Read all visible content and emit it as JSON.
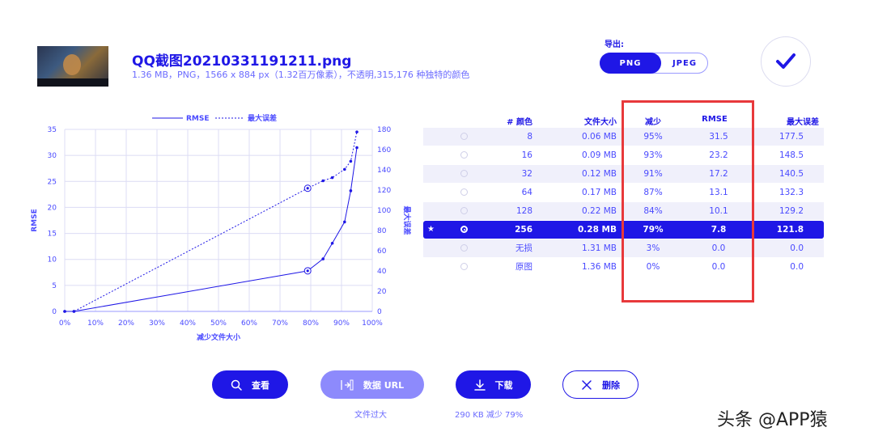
{
  "file": {
    "name": "QQ截图20210331191211.png",
    "info": "1.36 MB，PNG，1566 x 884 px（1.32百万像素），不透明,315,176 种独特的颜色"
  },
  "export": {
    "label": "导出:",
    "formats": [
      "PNG",
      "JPEG"
    ],
    "selected": "PNG"
  },
  "table": {
    "headers": [
      "# 颜色",
      "文件大小",
      "减少",
      "RMSE",
      "最大误差"
    ],
    "rows": [
      {
        "colors": "8",
        "size": "0.06 MB",
        "reduction": "95%",
        "rmse": "31.5",
        "max_error": "177.5",
        "selected": false
      },
      {
        "colors": "16",
        "size": "0.09 MB",
        "reduction": "93%",
        "rmse": "23.2",
        "max_error": "148.5",
        "selected": false
      },
      {
        "colors": "32",
        "size": "0.12 MB",
        "reduction": "91%",
        "rmse": "17.2",
        "max_error": "140.5",
        "selected": false
      },
      {
        "colors": "64",
        "size": "0.17 MB",
        "reduction": "87%",
        "rmse": "13.1",
        "max_error": "132.3",
        "selected": false
      },
      {
        "colors": "128",
        "size": "0.22 MB",
        "reduction": "84%",
        "rmse": "10.1",
        "max_error": "129.2",
        "selected": false
      },
      {
        "colors": "256",
        "size": "0.28 MB",
        "reduction": "79%",
        "rmse": "7.8",
        "max_error": "121.8",
        "selected": true
      },
      {
        "colors": "无损",
        "size": "1.31 MB",
        "reduction": "3%",
        "rmse": "0.0",
        "max_error": "0.0",
        "selected": false
      },
      {
        "colors": "原图",
        "size": "1.36 MB",
        "reduction": "0%",
        "rmse": "0.0",
        "max_error": "0.0",
        "selected": false
      }
    ]
  },
  "chart_data": {
    "type": "line",
    "xlabel": "减少文件大小",
    "ylabel": "RMSE",
    "y2label": "最大误差",
    "xlim": [
      0,
      100
    ],
    "ylim": [
      0,
      35
    ],
    "y2lim": [
      0,
      180
    ],
    "x_ticks": [
      "0%",
      "10%",
      "20%",
      "30%",
      "40%",
      "50%",
      "60%",
      "70%",
      "80%",
      "90%",
      "100%"
    ],
    "y_ticks": [
      "0",
      "5",
      "10",
      "15",
      "20",
      "25",
      "30",
      "35"
    ],
    "y2_ticks": [
      "0",
      "20",
      "40",
      "60",
      "80",
      "100",
      "120",
      "140",
      "160",
      "180"
    ],
    "legend": [
      "RMSE",
      "最大误差"
    ],
    "legend_position": "top",
    "grid": true,
    "series": [
      {
        "name": "RMSE",
        "style": "solid",
        "axis": "left",
        "x": [
          0,
          3,
          79,
          84,
          87,
          91,
          93,
          95
        ],
        "y": [
          0,
          0,
          7.8,
          10.1,
          13.1,
          17.2,
          23.2,
          31.5
        ],
        "highlight_index": 2
      },
      {
        "name": "最大误差",
        "style": "dotted",
        "axis": "right",
        "x": [
          0,
          3,
          79,
          84,
          87,
          91,
          93,
          95
        ],
        "y": [
          0,
          0,
          121.8,
          129.2,
          132.3,
          140.5,
          148.5,
          177.5
        ],
        "highlight_index": 2
      }
    ]
  },
  "buttons": {
    "view": "查看",
    "data_url": "数据 URL",
    "download": "下载",
    "delete": "删除"
  },
  "captions": {
    "data_url_note": "文件过大",
    "download_note": "290 KB  减少 79%"
  },
  "watermark": "头条 @APP猿",
  "colors": {
    "accent": "#1f17e6",
    "highlight_box": "#e8393b"
  }
}
